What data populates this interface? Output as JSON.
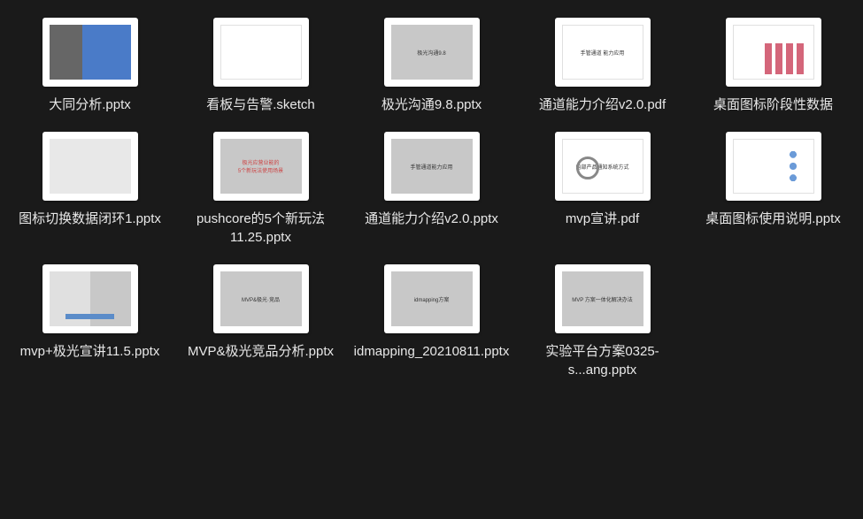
{
  "files": [
    {
      "name": "大同分析.pptx",
      "thumbStyle": "building"
    },
    {
      "name": "看板与告警.sketch",
      "thumbStyle": "white"
    },
    {
      "name": "极光沟通9.8.pptx",
      "thumbStyle": "gray",
      "thumbText": "极光沟通9.8"
    },
    {
      "name": "通道能力介绍v2.0.pdf",
      "thumbStyle": "white",
      "thumbText": "手管通道 能力应用"
    },
    {
      "name": "桌面图标阶段性数据",
      "thumbStyle": "pink-bars"
    },
    {
      "name": "图标切换数据闭环1.pptx",
      "thumbStyle": "gray-light"
    },
    {
      "name": "pushcore的5个新玩法11.25.pptx",
      "thumbStyle": "gray",
      "thumbText": "极光应营业能的\n5个新玩法使用场景",
      "redText": true
    },
    {
      "name": "通道能力介绍v2.0.pptx",
      "thumbStyle": "gray",
      "thumbText": "手管通道能力应用"
    },
    {
      "name": "mvp宣讲.pdf",
      "thumbStyle": "white-ring",
      "thumbText": "内部产品通知系统方式"
    },
    {
      "name": "桌面图标使用说明.pptx",
      "thumbStyle": "diagram"
    },
    {
      "name": "mvp+极光宣讲11.5.pptx",
      "thumbStyle": "gray-split"
    },
    {
      "name": "MVP&极光竞品分析.pptx",
      "thumbStyle": "gray",
      "thumbText": "MVP&极光·竞品"
    },
    {
      "name": "idmapping_20210811.pptx",
      "thumbStyle": "gray",
      "thumbText": "idmapping方案"
    },
    {
      "name": "实验平台方案0325-s...ang.pptx",
      "thumbStyle": "gray",
      "thumbText": "MVP 方案一体化解决办法"
    }
  ]
}
